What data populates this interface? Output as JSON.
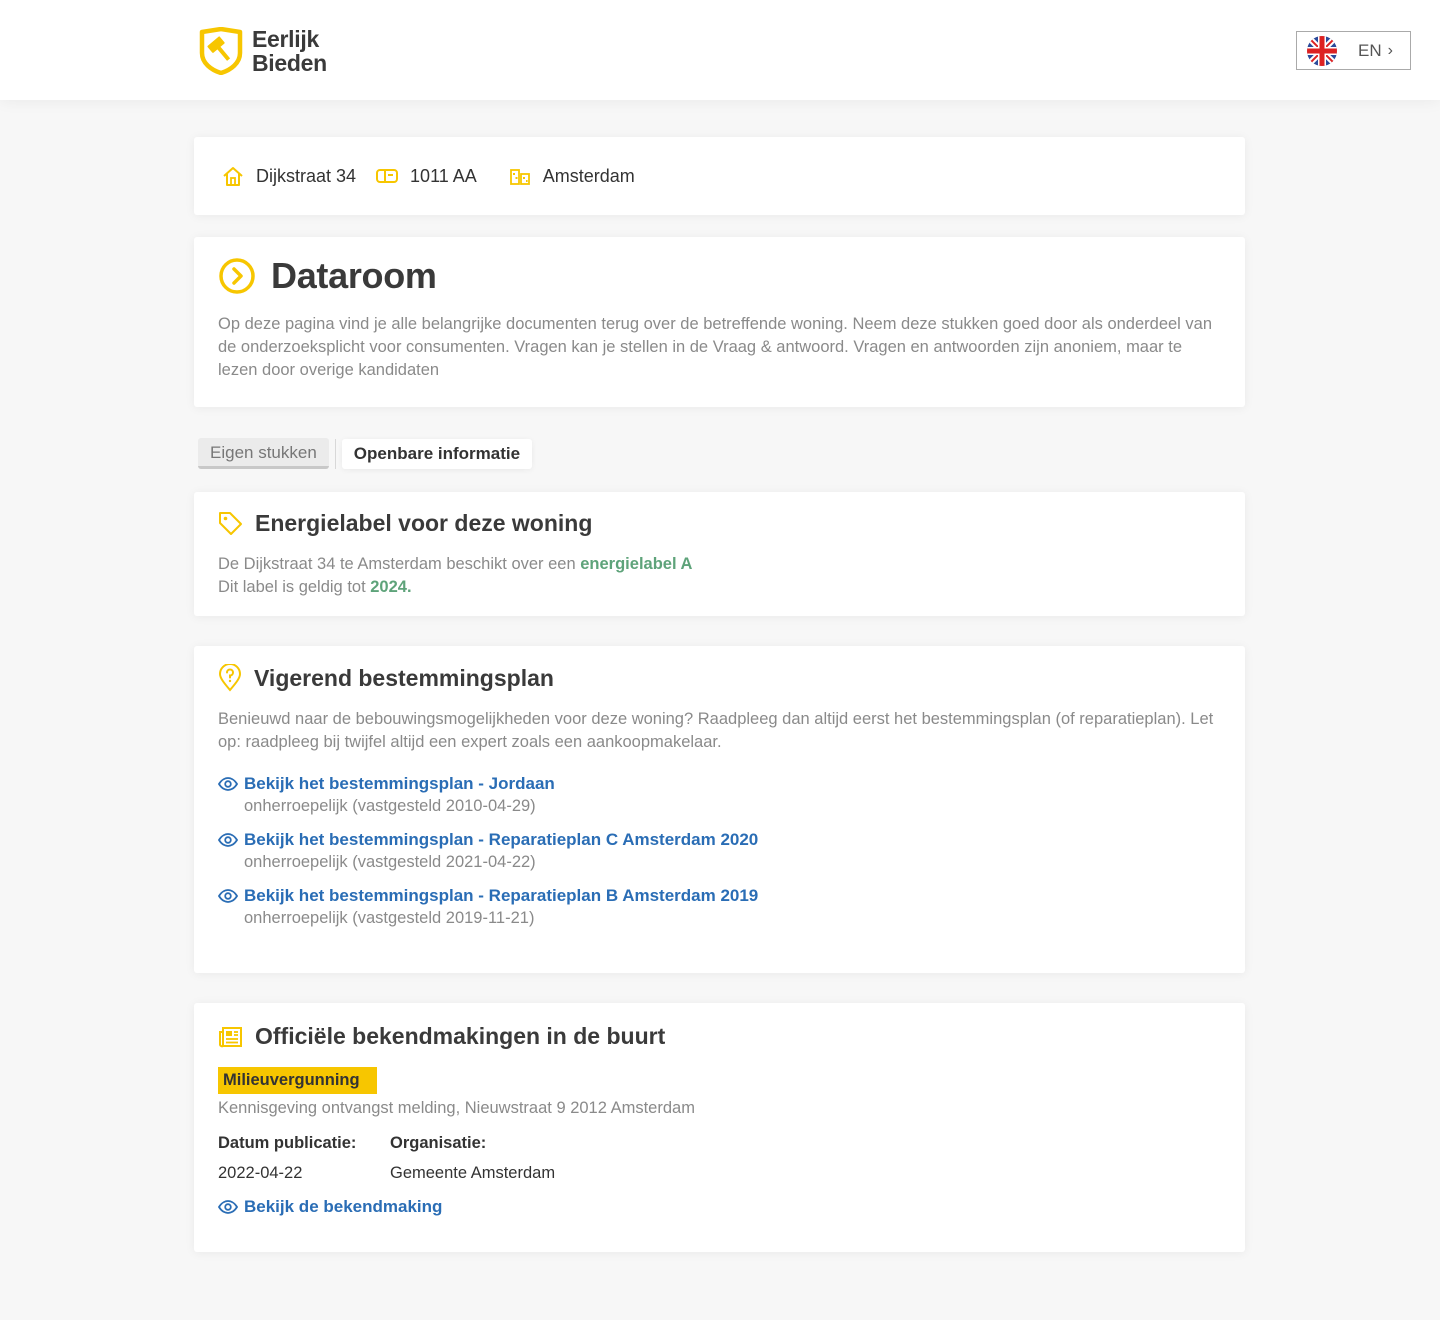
{
  "brand": {
    "line1": "Eerlijk",
    "line2": "Bieden",
    "accent": "#f7c600"
  },
  "language": {
    "code": "EN",
    "flag_icon": "uk-flag-icon"
  },
  "address": {
    "street": "Dijkstraat 34",
    "postcode": "1011 AA",
    "city": "Amsterdam"
  },
  "dataroom": {
    "title": "Dataroom",
    "intro": "Op deze pagina vind je alle belangrijke documenten terug over de betreffende woning. Neem deze stukken goed door als onderdeel van de onderzoeksplicht voor consumenten. Vragen kan je stellen in de Vraag & antwoord. Vragen en antwoorden zijn anoniem, maar te lezen door overige kandidaten"
  },
  "tabs": [
    {
      "label": "Eigen stukken",
      "active": true
    },
    {
      "label": "Openbare informatie",
      "active": false
    }
  ],
  "energy": {
    "title": "Energielabel voor deze woning",
    "line1_prefix": "De Dijkstraat 34 te Amsterdam beschikt over een ",
    "label": "energielabel A",
    "line2_prefix": "Dit label is geldig tot ",
    "valid_until": "2024.",
    "highlight_color": "#5ea37a"
  },
  "plan": {
    "title": "Vigerend bestemmingsplan",
    "intro": "Benieuwd naar de bebouwingsmogelijkheden voor deze woning? Raadpleeg dan altijd eerst het bestemmingsplan (of reparatieplan). Let op: raadpleeg bij twijfel altijd een expert zoals een aankoopmakelaar.",
    "items": [
      {
        "link": "Bekijk het bestemmingsplan - Jordaan",
        "status": "onherroepelijk (vastgesteld 2010-04-29)"
      },
      {
        "link": "Bekijk het bestemmingsplan -  Reparatieplan C Amsterdam 2020",
        "status": "onherroepelijk (vastgesteld 2021-04-22)"
      },
      {
        "link": "Bekijk het bestemmingsplan -  Reparatieplan B Amsterdam 2019",
        "status": "onherroepelijk (vastgesteld 2019-11-21)"
      }
    ],
    "link_color": "#2a6db5"
  },
  "notices": {
    "title": "Officiële bekendmakingen in de buurt",
    "badge": "Milieuvergunning",
    "description": "Kennisgeving ontvangst melding, Nieuwstraat 9 2012 Amsterdam",
    "date_label": "Datum publicatie:",
    "date_value": "2022-04-22",
    "org_label": "Organisatie:",
    "org_value": "Gemeente Amsterdam",
    "link": "Bekijk de bekendmaking"
  }
}
